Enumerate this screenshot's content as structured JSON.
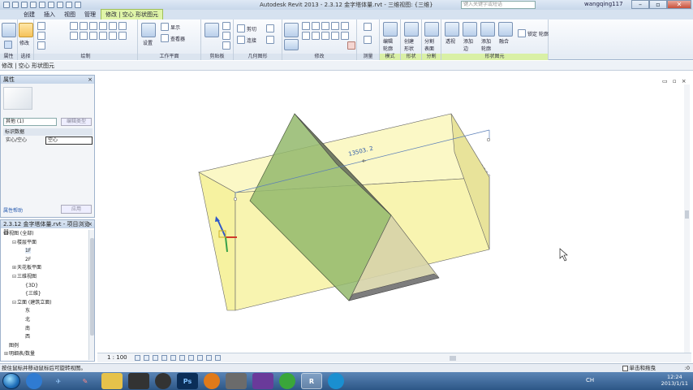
{
  "app": {
    "title": "Autodesk Revit 2013 -    2.3.12 金字塔体量.rvt - 三维视图: {三维}",
    "search_placeholder": "键入关键字或短语",
    "user": "wangqing117"
  },
  "ribbon": {
    "tabs": [
      "创建",
      "插入",
      "视图",
      "管理",
      "修改 | 空心 形状图元"
    ],
    "active_tab_index": 4,
    "panels": [
      "属性",
      "选择",
      "绘制",
      "工作平面",
      "剪贴板",
      "几何图形",
      "修改",
      "测量",
      "模式",
      "形状",
      "分割",
      "形状图元"
    ],
    "buttons": {
      "modify": "修改",
      "properties": "属性",
      "set": "设置",
      "show": "显示",
      "viewer": "查看器",
      "cut": "剪切",
      "join": "连接",
      "edit_profile": "编辑\n轮廓",
      "create_form": "创建\n形状",
      "divide_surface": "分割\n表面",
      "transparent": "透视",
      "add_edge": "添加\n边",
      "add_profile": "添加\n轮廓",
      "dissolve": "融合",
      "lock_profile": "锁定 轮廓"
    }
  },
  "modebar": {
    "text": "修改 | 空心 形状图元"
  },
  "properties": {
    "title": "属性",
    "close": "×",
    "type_selector": "其他 (1)",
    "edit_type": "编辑类型",
    "section": "标识数据",
    "rows": [
      {
        "key": "实心/空心",
        "value": "空心"
      }
    ],
    "help_link": "属性帮助",
    "apply": "应用"
  },
  "project_browser": {
    "title": "2.3.12 金字塔体量.rvt - 项目浏览器",
    "close": "×",
    "nodes": [
      {
        "label": "视图 (全部)",
        "toggle": "⊟",
        "indent": 0
      },
      {
        "label": "楼层平面",
        "toggle": "⊟",
        "indent": 1
      },
      {
        "label": "1F",
        "toggle": "",
        "indent": 2,
        "selected": true
      },
      {
        "label": "2F",
        "toggle": "",
        "indent": 2
      },
      {
        "label": "天花板平面",
        "toggle": "⊞",
        "indent": 1
      },
      {
        "label": "三维视图",
        "toggle": "⊟",
        "indent": 1
      },
      {
        "label": "{3D}",
        "toggle": "",
        "indent": 2
      },
      {
        "label": "{三维}",
        "toggle": "",
        "indent": 2
      },
      {
        "label": "立面 (建筑立面)",
        "toggle": "⊟",
        "indent": 1
      },
      {
        "label": "东",
        "toggle": "",
        "indent": 2
      },
      {
        "label": "北",
        "toggle": "",
        "indent": 2
      },
      {
        "label": "南",
        "toggle": "",
        "indent": 2
      },
      {
        "label": "西",
        "toggle": "",
        "indent": 2
      },
      {
        "label": "图例",
        "toggle": "",
        "indent": 0
      },
      {
        "label": "明细表/数量",
        "toggle": "⊞",
        "indent": 0
      }
    ]
  },
  "canvas": {
    "dimension_label": "13503. 2",
    "view_controls": "▭ ▫ ×"
  },
  "viewbar": {
    "scale": "1 : 100"
  },
  "status": {
    "message": "按住鼠标并移动鼠标后可旋转视图。",
    "press_drag_label": "单击和拖曳",
    "filter_count": ":0"
  },
  "taskbar": {
    "lang": "CH",
    "time": "12:24",
    "date": "2013/1/11"
  },
  "colors": {
    "box_fill": "#f7f4a8",
    "pyramid_fill": "#9cbf73",
    "pyramid_dark": "#5e6b57",
    "ribbon_context": "#dff5a8"
  }
}
